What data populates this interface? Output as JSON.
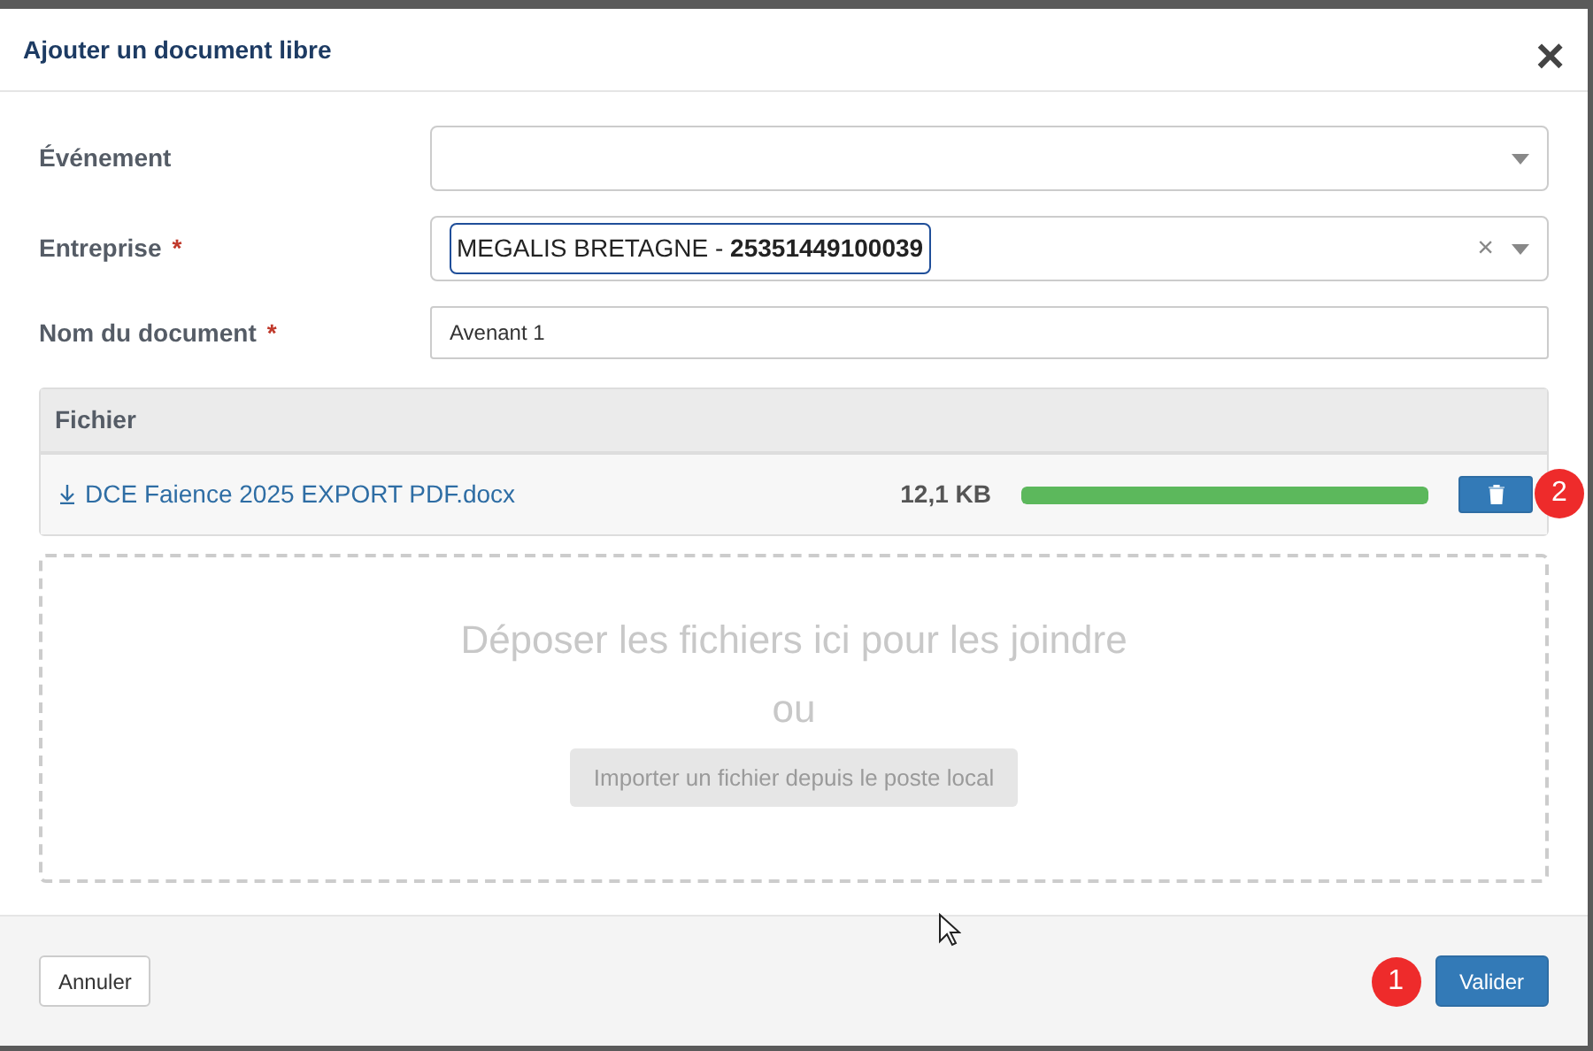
{
  "dialog": {
    "title": "Ajouter un document libre",
    "close": "×"
  },
  "fields": [
    {
      "kind": "select",
      "label": "Événement",
      "required": false
    },
    {
      "kind": "select",
      "label": "Entreprise",
      "required": true,
      "value": "MEGALIS BRETAGNE - **25351449100039**",
      "clear": "×"
    },
    {
      "kind": "text",
      "label": "Nom du document",
      "required": true,
      "value": "Avenant 1"
    }
  ],
  "required_mark": "*",
  "files": {
    "header": "Fichier",
    "rows": [
      {
        "name": "DCE Faience 2025 EXPORT PDF.docx",
        "size": "12,1 KB",
        "level": 1,
        "badge": "2"
      }
    ]
  },
  "dropzone": {
    "text": "Déposer les fichiers ici pour les joindre",
    "or": "ou",
    "button": "Importer un fichier depuis le poste local"
  },
  "footer": {
    "cancel": "Annuler",
    "submit": "Valider",
    "badge": "1"
  }
}
